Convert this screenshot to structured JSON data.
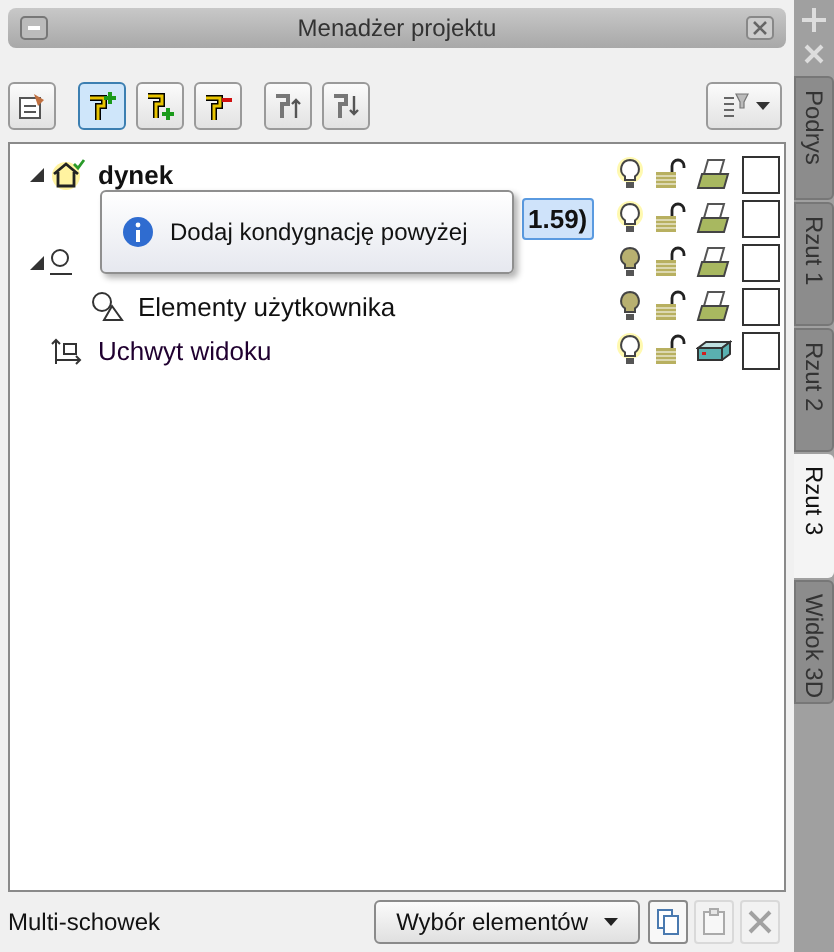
{
  "window": {
    "title": "Menadżer projektu"
  },
  "toolbar": [
    {
      "kind": "properties",
      "selected": false
    },
    {
      "kind": "add-above",
      "selected": true
    },
    {
      "kind": "add-below",
      "selected": false
    },
    {
      "kind": "remove",
      "selected": false
    },
    {
      "kind": "move-up",
      "selected": false
    },
    {
      "kind": "move-down",
      "selected": false
    },
    {
      "kind": "filter",
      "selected": false
    }
  ],
  "tree": [
    {
      "kind": "building",
      "label": "dynek",
      "expanded": true,
      "light": true,
      "checked": false,
      "selected": false,
      "children": [
        {
          "kind": "level",
          "label": "1.59)",
          "light": true,
          "checked": false,
          "selected": true
        }
      ]
    },
    {
      "kind": "group",
      "expanded": true,
      "light": false,
      "checked": false,
      "selected": false,
      "children": [
        {
          "kind": "user-elements",
          "label": "Elementy użytkownika",
          "light": false,
          "checked": false,
          "selected": false
        }
      ]
    },
    {
      "kind": "view-handle",
      "label": "Uchwyt widoku",
      "light": true,
      "checked": false,
      "selected": false
    }
  ],
  "tooltip": {
    "text": "Dodaj kondygnację powyżej"
  },
  "footer": {
    "label": "Multi-schowek",
    "dropdown": "Wybór elementów",
    "buttons": [
      {
        "kind": "copy",
        "disabled": false
      },
      {
        "kind": "paste",
        "disabled": true
      },
      {
        "kind": "delete",
        "disabled": true
      }
    ]
  },
  "side_tabs": [
    {
      "label": "Podrys",
      "selected": false
    },
    {
      "label": "Rzut 1",
      "selected": false
    },
    {
      "label": "Rzut 2",
      "selected": false
    },
    {
      "label": "Rzut 3",
      "selected": true
    },
    {
      "label": "Widok 3D",
      "selected": false
    }
  ]
}
